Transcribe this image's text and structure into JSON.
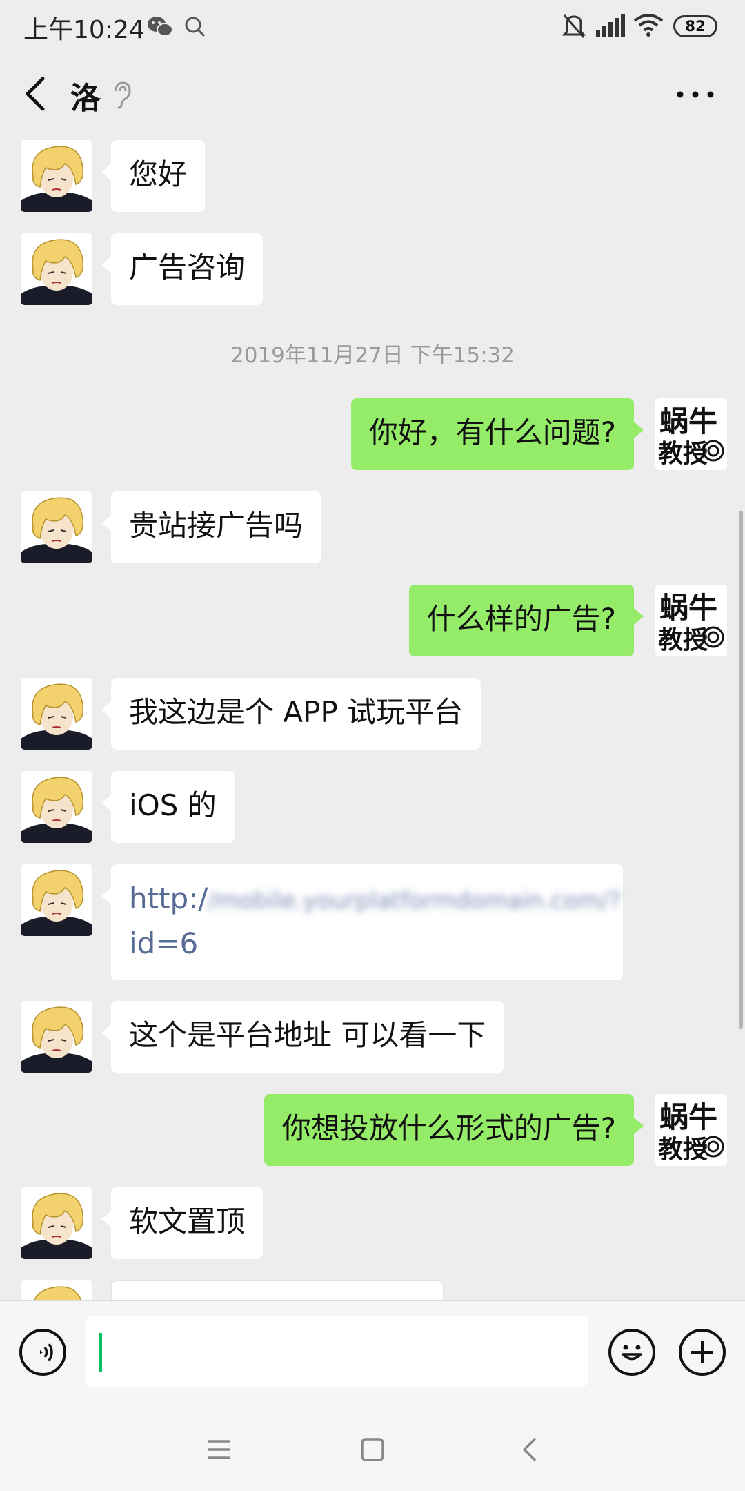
{
  "status_bar": {
    "time": "上午10:24",
    "battery": "82",
    "icons": [
      "wechat-icon",
      "search-icon",
      "bell-off-icon",
      "signal-icon",
      "wifi-icon",
      "battery-icon"
    ]
  },
  "header": {
    "title": "洛",
    "back_icon": "chevron-left-icon",
    "mute_icon": "ear-icon",
    "more_icon": "more-icon"
  },
  "messages": [
    {
      "side": "in",
      "text": "您好"
    },
    {
      "side": "in",
      "text": "广告咨询"
    },
    {
      "type": "time",
      "text": "2019年11月27日 下午15:32"
    },
    {
      "side": "out",
      "text": "你好，有什么问题?"
    },
    {
      "side": "in",
      "text": "贵站接广告吗"
    },
    {
      "side": "out",
      "text": "什么样的广告?"
    },
    {
      "side": "in",
      "text": "我这边是个 APP 试玩平台"
    },
    {
      "side": "in",
      "text": "iOS 的"
    },
    {
      "side": "in",
      "type": "link",
      "text_prefix": "http:/",
      "text_blurred": "/mobile.yourplatformdomain.com/?",
      "text_suffix": "id=6"
    },
    {
      "side": "in",
      "text": "这个是平台地址 可以看一下"
    },
    {
      "side": "out",
      "text": "你想投放什么形式的广告?"
    },
    {
      "side": "in",
      "text": "软文置顶"
    }
  ],
  "self_avatar_text": [
    "蜗牛",
    "教授"
  ],
  "input_bar": {
    "voice_icon": "voice-icon",
    "emoji_icon": "emoji-icon",
    "plus_icon": "plus-icon",
    "value": ""
  },
  "nav_bar": {
    "icons": [
      "menu-icon",
      "home-icon",
      "back-icon"
    ]
  },
  "colors": {
    "bubble_out": "#95ec69",
    "bubble_in": "#ffffff",
    "background": "#ededed",
    "link": "#576b95",
    "caret": "#07c160"
  }
}
